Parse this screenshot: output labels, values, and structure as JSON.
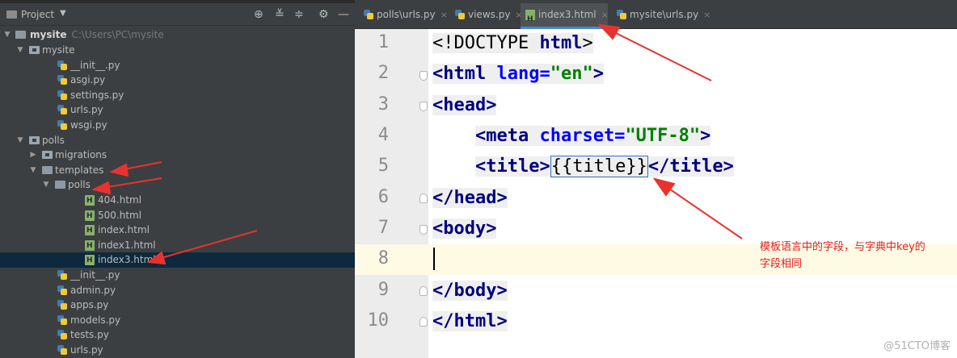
{
  "project_panel": {
    "title": "Project",
    "root": {
      "name": "mysite",
      "path": "C:\\Users\\PC\\mysite"
    },
    "tree": [
      {
        "label": "mysite",
        "type": "pkg",
        "depth": 1,
        "expanded": true
      },
      {
        "label": "__init__.py",
        "type": "py",
        "depth": 2
      },
      {
        "label": "asgi.py",
        "type": "py",
        "depth": 2
      },
      {
        "label": "settings.py",
        "type": "py",
        "depth": 2
      },
      {
        "label": "urls.py",
        "type": "py",
        "depth": 2
      },
      {
        "label": "wsgi.py",
        "type": "py",
        "depth": 2
      },
      {
        "label": "polls",
        "type": "pkg",
        "depth": 1,
        "expanded": true
      },
      {
        "label": "migrations",
        "type": "pkg",
        "depth": 2,
        "expanded": false
      },
      {
        "label": "templates",
        "type": "folder",
        "depth": 2,
        "expanded": true
      },
      {
        "label": "polls",
        "type": "folder",
        "depth": 3,
        "expanded": true
      },
      {
        "label": "404.html",
        "type": "html",
        "depth": 4
      },
      {
        "label": "500.html",
        "type": "html",
        "depth": 4
      },
      {
        "label": "index.html",
        "type": "html",
        "depth": 4
      },
      {
        "label": "index1.html",
        "type": "html",
        "depth": 4
      },
      {
        "label": "index3.html",
        "type": "html",
        "depth": 4,
        "selected": true
      },
      {
        "label": "__init__.py",
        "type": "py",
        "depth": 2
      },
      {
        "label": "admin.py",
        "type": "py",
        "depth": 2
      },
      {
        "label": "apps.py",
        "type": "py",
        "depth": 2
      },
      {
        "label": "models.py",
        "type": "py",
        "depth": 2
      },
      {
        "label": "tests.py",
        "type": "py",
        "depth": 2
      },
      {
        "label": "urls.py",
        "type": "py",
        "depth": 2
      }
    ]
  },
  "tabs": [
    {
      "label": "polls\\urls.py",
      "icon": "python-file-icon",
      "active": false
    },
    {
      "label": "views.py",
      "icon": "python-file-icon",
      "active": false
    },
    {
      "label": "index3.html",
      "icon": "html-file-icon",
      "active": true
    },
    {
      "label": "mysite\\urls.py",
      "icon": "python-file-icon",
      "active": false
    }
  ],
  "editor": {
    "line_numbers": [
      "1",
      "2",
      "3",
      "4",
      "5",
      "6",
      "7",
      "8",
      "9",
      "10"
    ],
    "current_line": "8",
    "code": {
      "l1_open": "<!DOCTYPE ",
      "l1_kw": "html",
      "l1_close": ">",
      "l2_tag": "<html ",
      "l2_attr": "lang=",
      "l2_val": "\"en\"",
      "l2_close": ">",
      "l3": "<head>",
      "l4_tag": "<meta ",
      "l4_attr": "charset=",
      "l4_val": "\"UTF-8\"",
      "l4_close": ">",
      "l5_open": "<title>",
      "l5_tpl": "{{title}}",
      "l5_close": "</title>",
      "l6": "</head>",
      "l7": "<body>",
      "l9": "</body>",
      "l10": "</html>"
    }
  },
  "annotation": {
    "line1": "模板语言中的字段，与字典中key的",
    "line2": "字段相同",
    "color": "#e02020"
  },
  "watermark": "@51CTO博客",
  "colors": {
    "panel_bg": "#3c3f41",
    "selection": "#0d293e",
    "tag": "#000080",
    "attr": "#0000ff",
    "string": "#008000",
    "arrow": "#e8322f"
  }
}
